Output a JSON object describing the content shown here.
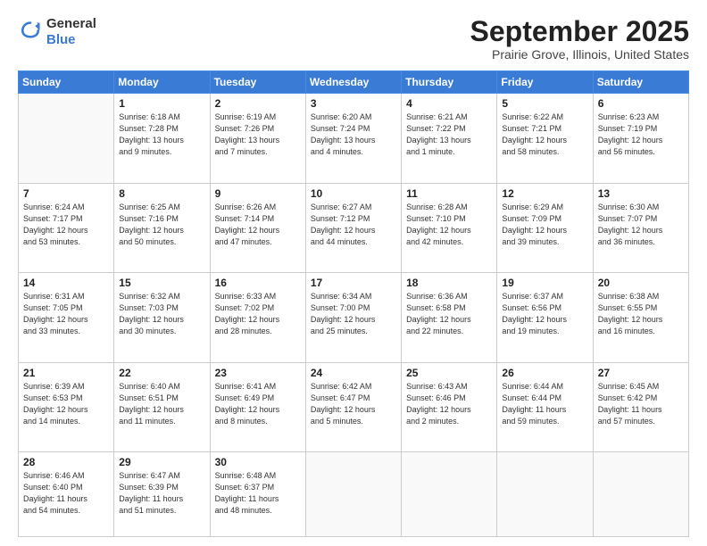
{
  "header": {
    "logo": {
      "line1": "General",
      "line2": "Blue"
    },
    "title": "September 2025",
    "location": "Prairie Grove, Illinois, United States"
  },
  "calendar": {
    "weekdays": [
      "Sunday",
      "Monday",
      "Tuesday",
      "Wednesday",
      "Thursday",
      "Friday",
      "Saturday"
    ],
    "weeks": [
      [
        {
          "day": "",
          "info": ""
        },
        {
          "day": "1",
          "info": "Sunrise: 6:18 AM\nSunset: 7:28 PM\nDaylight: 13 hours\nand 9 minutes."
        },
        {
          "day": "2",
          "info": "Sunrise: 6:19 AM\nSunset: 7:26 PM\nDaylight: 13 hours\nand 7 minutes."
        },
        {
          "day": "3",
          "info": "Sunrise: 6:20 AM\nSunset: 7:24 PM\nDaylight: 13 hours\nand 4 minutes."
        },
        {
          "day": "4",
          "info": "Sunrise: 6:21 AM\nSunset: 7:22 PM\nDaylight: 13 hours\nand 1 minute."
        },
        {
          "day": "5",
          "info": "Sunrise: 6:22 AM\nSunset: 7:21 PM\nDaylight: 12 hours\nand 58 minutes."
        },
        {
          "day": "6",
          "info": "Sunrise: 6:23 AM\nSunset: 7:19 PM\nDaylight: 12 hours\nand 56 minutes."
        }
      ],
      [
        {
          "day": "7",
          "info": "Sunrise: 6:24 AM\nSunset: 7:17 PM\nDaylight: 12 hours\nand 53 minutes."
        },
        {
          "day": "8",
          "info": "Sunrise: 6:25 AM\nSunset: 7:16 PM\nDaylight: 12 hours\nand 50 minutes."
        },
        {
          "day": "9",
          "info": "Sunrise: 6:26 AM\nSunset: 7:14 PM\nDaylight: 12 hours\nand 47 minutes."
        },
        {
          "day": "10",
          "info": "Sunrise: 6:27 AM\nSunset: 7:12 PM\nDaylight: 12 hours\nand 44 minutes."
        },
        {
          "day": "11",
          "info": "Sunrise: 6:28 AM\nSunset: 7:10 PM\nDaylight: 12 hours\nand 42 minutes."
        },
        {
          "day": "12",
          "info": "Sunrise: 6:29 AM\nSunset: 7:09 PM\nDaylight: 12 hours\nand 39 minutes."
        },
        {
          "day": "13",
          "info": "Sunrise: 6:30 AM\nSunset: 7:07 PM\nDaylight: 12 hours\nand 36 minutes."
        }
      ],
      [
        {
          "day": "14",
          "info": "Sunrise: 6:31 AM\nSunset: 7:05 PM\nDaylight: 12 hours\nand 33 minutes."
        },
        {
          "day": "15",
          "info": "Sunrise: 6:32 AM\nSunset: 7:03 PM\nDaylight: 12 hours\nand 30 minutes."
        },
        {
          "day": "16",
          "info": "Sunrise: 6:33 AM\nSunset: 7:02 PM\nDaylight: 12 hours\nand 28 minutes."
        },
        {
          "day": "17",
          "info": "Sunrise: 6:34 AM\nSunset: 7:00 PM\nDaylight: 12 hours\nand 25 minutes."
        },
        {
          "day": "18",
          "info": "Sunrise: 6:36 AM\nSunset: 6:58 PM\nDaylight: 12 hours\nand 22 minutes."
        },
        {
          "day": "19",
          "info": "Sunrise: 6:37 AM\nSunset: 6:56 PM\nDaylight: 12 hours\nand 19 minutes."
        },
        {
          "day": "20",
          "info": "Sunrise: 6:38 AM\nSunset: 6:55 PM\nDaylight: 12 hours\nand 16 minutes."
        }
      ],
      [
        {
          "day": "21",
          "info": "Sunrise: 6:39 AM\nSunset: 6:53 PM\nDaylight: 12 hours\nand 14 minutes."
        },
        {
          "day": "22",
          "info": "Sunrise: 6:40 AM\nSunset: 6:51 PM\nDaylight: 12 hours\nand 11 minutes."
        },
        {
          "day": "23",
          "info": "Sunrise: 6:41 AM\nSunset: 6:49 PM\nDaylight: 12 hours\nand 8 minutes."
        },
        {
          "day": "24",
          "info": "Sunrise: 6:42 AM\nSunset: 6:47 PM\nDaylight: 12 hours\nand 5 minutes."
        },
        {
          "day": "25",
          "info": "Sunrise: 6:43 AM\nSunset: 6:46 PM\nDaylight: 12 hours\nand 2 minutes."
        },
        {
          "day": "26",
          "info": "Sunrise: 6:44 AM\nSunset: 6:44 PM\nDaylight: 11 hours\nand 59 minutes."
        },
        {
          "day": "27",
          "info": "Sunrise: 6:45 AM\nSunset: 6:42 PM\nDaylight: 11 hours\nand 57 minutes."
        }
      ],
      [
        {
          "day": "28",
          "info": "Sunrise: 6:46 AM\nSunset: 6:40 PM\nDaylight: 11 hours\nand 54 minutes."
        },
        {
          "day": "29",
          "info": "Sunrise: 6:47 AM\nSunset: 6:39 PM\nDaylight: 11 hours\nand 51 minutes."
        },
        {
          "day": "30",
          "info": "Sunrise: 6:48 AM\nSunset: 6:37 PM\nDaylight: 11 hours\nand 48 minutes."
        },
        {
          "day": "",
          "info": ""
        },
        {
          "day": "",
          "info": ""
        },
        {
          "day": "",
          "info": ""
        },
        {
          "day": "",
          "info": ""
        }
      ]
    ]
  }
}
